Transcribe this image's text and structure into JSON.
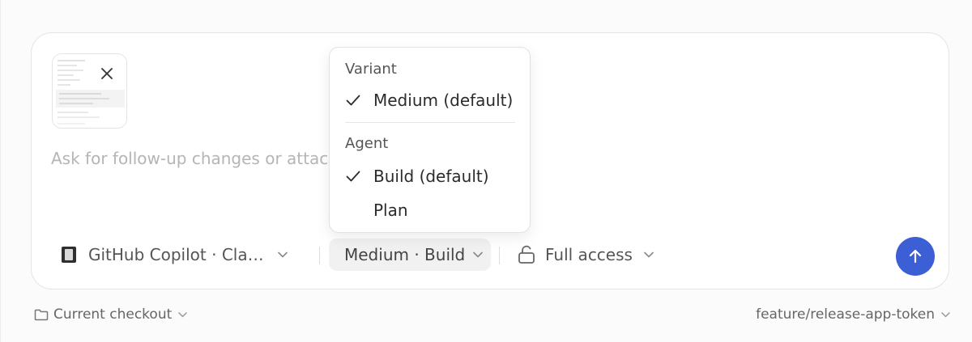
{
  "composer": {
    "placeholder": "Ask for follow-up changes or attach",
    "attachment": {
      "icon": "close-icon"
    },
    "toolbar": {
      "model_label": "GitHub Copilot · Claude",
      "model_icon": "app-icon",
      "variant_label": "Medium · Build",
      "access_label": "Full access",
      "access_icon": "lock-icon",
      "send_icon": "arrow-up-icon"
    }
  },
  "dropdown": {
    "variant_heading": "Variant",
    "variant_items": [
      {
        "label": "Medium (default)",
        "checked": true
      }
    ],
    "agent_heading": "Agent",
    "agent_items": [
      {
        "label": "Build (default)",
        "checked": true
      },
      {
        "label": "Plan",
        "checked": false
      }
    ]
  },
  "footer": {
    "checkout_label": "Current checkout",
    "checkout_icon": "folder-icon",
    "branch_label": "feature/release-app-token"
  },
  "colors": {
    "accent": "#3d5fd6",
    "background": "#fbfbfb",
    "panel": "#ffffff",
    "placeholder": "#b5b5b5"
  }
}
